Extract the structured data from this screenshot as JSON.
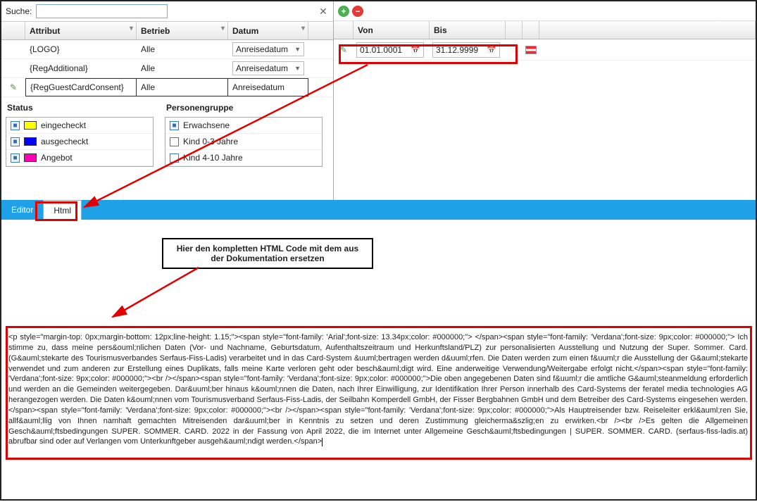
{
  "search": {
    "label": "Suche:",
    "value": ""
  },
  "columns": {
    "attr": "Attribut",
    "betrieb": "Betrieb",
    "datum": "Datum"
  },
  "rows": [
    {
      "attr": "{LOGO}",
      "betrieb": "Alle",
      "datum": "Anreisedatum",
      "dd": true
    },
    {
      "attr": "{RegAdditional}",
      "betrieb": "Alle",
      "datum": "Anreisedatum",
      "dd": true
    },
    {
      "attr": "{RegGuestCardConsent}",
      "betrieb": "Alle",
      "datum": "Anreisedatum",
      "dd": false,
      "selected": true
    }
  ],
  "status": {
    "title": "Status",
    "items": [
      {
        "label": "eingecheckt",
        "checked": true,
        "color": "clr-yellow"
      },
      {
        "label": "ausgecheckt",
        "checked": true,
        "color": "clr-blue"
      },
      {
        "label": "Angebot",
        "checked": true,
        "color": "clr-pink"
      }
    ]
  },
  "personen": {
    "title": "Personengruppe",
    "items": [
      {
        "label": "Erwachsene",
        "checked": true
      },
      {
        "label": "Kind 0-3 Jahre",
        "checked": false
      },
      {
        "label": "Kind 4-10 Jahre",
        "checked": false
      }
    ]
  },
  "right": {
    "von": "Von",
    "bis": "Bis",
    "row": {
      "von": "01.01.0001",
      "bis": "31.12.9999"
    }
  },
  "tabs": {
    "editor": "Editor",
    "html": "Html"
  },
  "instruction": "Hier den kompletten HTML Code mit dem aus der Dokumentation ersetzen",
  "code": "<p style=\"margin-top: 0px;margin-bottom: 12px;line-height: 1.15;\"><span style=\"font-family: 'Arial';font-size: 13.34px;color: #000000;\"> </span><span style=\"font-family: 'Verdana';font-size: 9px;color: #000000;\"> Ich stimme zu, dass meine pers&ouml;nlichen Daten (Vor- und Nachname, Geburtsdatum, Aufenthaltszeitraum und Herkunftsland/PLZ) zur personalisierten Ausstellung und Nutzung der Super. Sommer. Card. (G&auml;stekarte des Tourismusverbandes Serfaus-Fiss-Ladis) verarbeitet und in das Card-System &uuml;bertragen werden d&uuml;rfen. Die Daten werden zum einen f&uuml;r die Ausstellung der G&auml;stekarte verwendet und zum anderen zur Erstellung eines Duplikats, falls meine Karte verloren geht oder besch&auml;digt wird. Eine anderweitige Verwendung/Weitergabe erfolgt nicht.</span><span style=\"font-family: 'Verdana';font-size: 9px;color: #000000;\"><br /></span><span style=\"font-family: 'Verdana';font-size: 9px;color: #000000;\">Die oben angegebenen Daten sind f&uuml;r die amtliche G&auml;steanmeldung erforderlich und werden an die Gemeinden weitergegeben. Dar&uuml;ber hinaus k&ouml;nnen die Daten, nach Ihrer Einwilligung, zur Identifikation Ihrer Person innerhalb des Card-Systems der feratel media technologies AG herangezogen werden. Die Daten k&ouml;nnen vom Tourismusverband Serfaus-Fiss-Ladis, der Seilbahn Komperdell GmbH, der Fisser Bergbahnen GmbH und dem Betreiber des Card-Systems eingesehen werden.</span><span style=\"font-family: 'Verdana';font-size: 9px;color: #000000;\"><br /></span><span style=\"font-family: 'Verdana';font-size: 9px;color: #000000;\">Als Hauptreisender bzw. Reiseleiter erkl&auml;ren Sie, allf&auml;llig von Ihnen namhaft gemachten Mitreisenden dar&uuml;ber in Kenntnis zu setzen und deren Zustimmung gleicherma&szlig;en zu erwirken.<br /><br />Es gelten die Allgemeinen Gesch&auml;ftsbedingungen SUPER. SOMMER. CARD. 2022 in der Fassung von April 2022, die im Internet unter Allgemeine Gesch&auml;ftsbedingungen | SUPER. SOMMER. CARD. (serfaus-fiss-ladis.at) abrufbar sind oder auf Verlangen vom Unterkunftgeber ausgeh&auml;ndigt werden.</span>"
}
